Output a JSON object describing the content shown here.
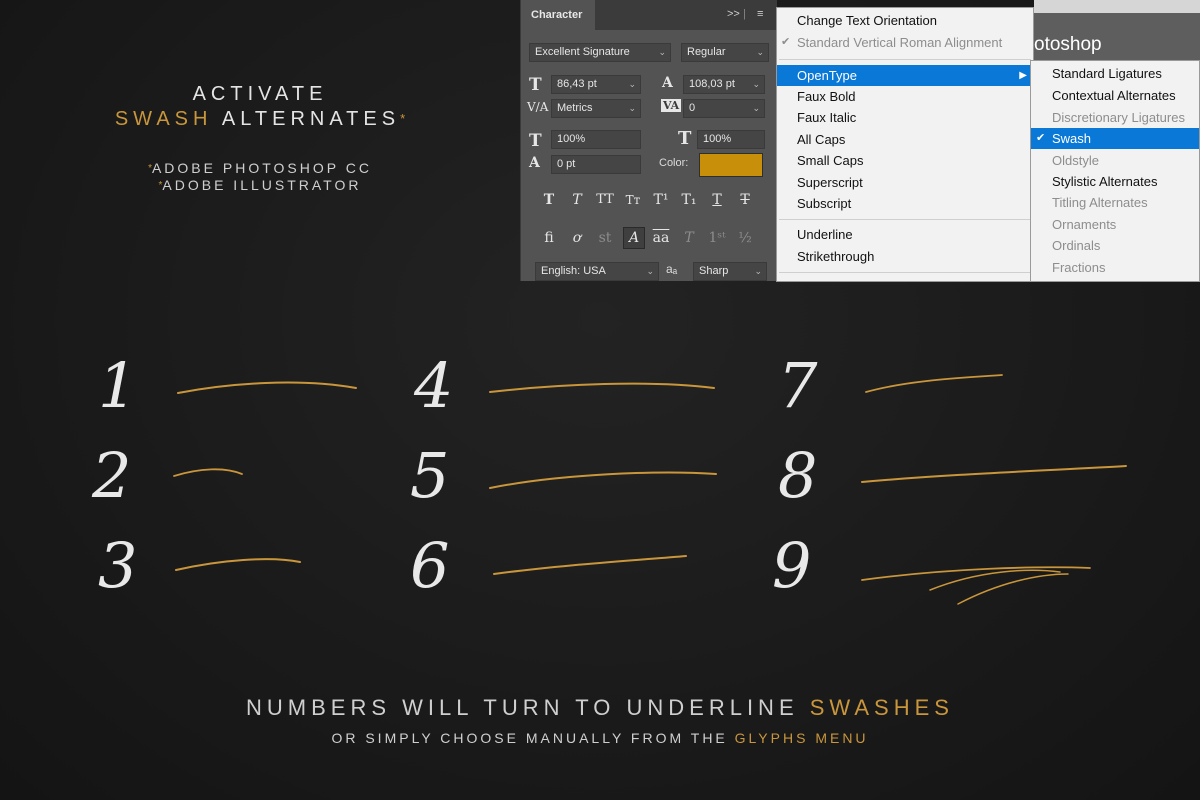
{
  "heading": {
    "line1": "ACTIVATE",
    "line2_gold": "SWASH",
    "line2_rest": "ALTERNATES",
    "star": "*"
  },
  "apps": [
    "ADOBE PHOTOSHOP CC",
    "ADOBE ILLUSTRATOR"
  ],
  "character_panel": {
    "tab": "Character",
    "collapse": ">>",
    "menu_icon": "≡",
    "font_family": "Excellent Signature",
    "font_style": "Regular",
    "font_size": "86,43 pt",
    "leading": "108,03 pt",
    "kerning": "Metrics",
    "tracking": "0",
    "vertical_scale": "100%",
    "horizontal_scale": "100%",
    "baseline_shift": "0 pt",
    "color_label": "Color:",
    "color": "#c8900a",
    "language": "English: USA",
    "aa_label": "aₐ",
    "antialias": "Sharp"
  },
  "menu": {
    "items": [
      {
        "label": "Change Text Orientation",
        "state": "normal"
      },
      {
        "label": "Standard Vertical Roman Alignment",
        "state": "disabled",
        "checked": true
      },
      {
        "label": "OpenType",
        "state": "highlight"
      },
      {
        "label": "Faux Bold",
        "state": "normal"
      },
      {
        "label": "Faux Italic",
        "state": "normal"
      },
      {
        "label": "All Caps",
        "state": "normal"
      },
      {
        "label": "Small Caps",
        "state": "normal"
      },
      {
        "label": "Superscript",
        "state": "normal"
      },
      {
        "label": "Subscript",
        "state": "normal"
      },
      {
        "label": "Underline",
        "state": "normal"
      },
      {
        "label": "Strikethrough",
        "state": "normal"
      }
    ],
    "background_title": "otoshop"
  },
  "submenu": {
    "items": [
      {
        "label": "Standard Ligatures",
        "state": "normal"
      },
      {
        "label": "Contextual Alternates",
        "state": "normal"
      },
      {
        "label": "Discretionary Ligatures",
        "state": "disabled"
      },
      {
        "label": "Swash",
        "state": "highlight",
        "checked": true
      },
      {
        "label": "Oldstyle",
        "state": "disabled"
      },
      {
        "label": "Stylistic Alternates",
        "state": "normal"
      },
      {
        "label": "Titling Alternates",
        "state": "disabled"
      },
      {
        "label": "Ornaments",
        "state": "disabled"
      },
      {
        "label": "Ordinals",
        "state": "disabled"
      },
      {
        "label": "Fractions",
        "state": "disabled"
      }
    ]
  },
  "numerals": [
    "1",
    "2",
    "3",
    "4",
    "5",
    "6",
    "7",
    "8",
    "9"
  ],
  "footer": {
    "line1_main": "NUMBERS WILL TURN TO UNDERLINE",
    "line1_gold": "SWASHES",
    "line2_main": "OR SIMPLY CHOOSE MANUALLY FROM THE",
    "line2_gold": "GLYPHS MENU"
  },
  "colors": {
    "accent": "#c9963b",
    "background": "#1c1c1c",
    "menu_highlight": "#0a78d7"
  }
}
